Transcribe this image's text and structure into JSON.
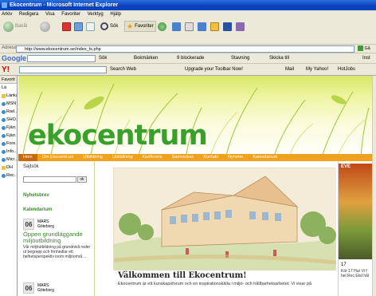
{
  "window": {
    "title": "Ekocentrum - Microsoft Internet Explorer"
  },
  "menu": [
    "Arkiv",
    "Redigera",
    "Visa",
    "Favoriter",
    "Verktyg",
    "Hjälp"
  ],
  "toolbar": {
    "back": "Bakåt",
    "search": "Sök",
    "favorites": "Favoriter"
  },
  "address": {
    "label": "Adress",
    "url": "http://www.ekocentrum.se/index_ts.php",
    "go": "Gå till"
  },
  "googlebar": {
    "brand": "Google",
    "search_btn": "Sök",
    "bookmarks": "Bokmärken",
    "blocked": "9 blockerade",
    "spelling": "Stavning",
    "send": "Skicka till",
    "settings": "Inst"
  },
  "yahoobar": {
    "search_btn": "Search Web",
    "upgrade": "Upgrade your Toolbar Now!",
    "mail": "Mail",
    "myyahoo": "My Yahoo!",
    "hotjobs": "HotJobs"
  },
  "favorites": {
    "header": "Favorit",
    "add": "Lä",
    "items": [
      {
        "label": "Länkar",
        "icon": "folder"
      },
      {
        "label": "MSN",
        "icon": "page"
      },
      {
        "label": "Rad...",
        "icon": "page"
      },
      {
        "label": "SHO...",
        "icon": "page"
      },
      {
        "label": "Fjärr...",
        "icon": "page"
      },
      {
        "label": "Fjärr...",
        "icon": "page"
      },
      {
        "label": "Fore...",
        "icon": "page"
      },
      {
        "label": "Info...",
        "icon": "page"
      },
      {
        "label": "Micr...",
        "icon": "page"
      },
      {
        "label": "DH",
        "icon": "folder"
      },
      {
        "label": "Rec...",
        "icon": "page"
      }
    ]
  },
  "site": {
    "logo": "ekocentrum",
    "nav": [
      "Hem",
      "Om Ekocentrum",
      "Utbildning",
      "Utställning",
      "Konferens",
      "Samverkan",
      "Kontakt",
      "Nyheter",
      "Kalendarium"
    ],
    "sidebar": {
      "search_label": "Sajtsök",
      "ok": "ok",
      "newsletter": "Nyhetsbrev",
      "calendar": "Kalendarium",
      "events": [
        {
          "day": "06",
          "month": "MARS",
          "place": "Göteborg",
          "title": "Öppen grundläggande miljöutbildning",
          "text": "Vår miljöutbildning på grundnivå reder ut begrepp och förmedlar ett helhetsperspektiv inom miljöområ ..."
        },
        {
          "day": "06",
          "month": "MARS",
          "place": "Göteborg",
          "title": "",
          "text": ""
        }
      ]
    },
    "main": {
      "heading": "Välkommen till Ekocentrum!",
      "intro": "Ekocentrum är ett kunskapsforum och en inspirationskälla i miljö- och hållbarhetsarbetet. Vi visar på"
    },
    "right": {
      "badge": "EVE",
      "day": "17",
      "text": "Kör 17 Hur Vi f hel Rec Ekd hål"
    }
  },
  "colors": {
    "titlebar": "#0a3fb8",
    "nav": "#f0a21c",
    "green": "#3aa02c",
    "chrome": "#ece9d8"
  }
}
